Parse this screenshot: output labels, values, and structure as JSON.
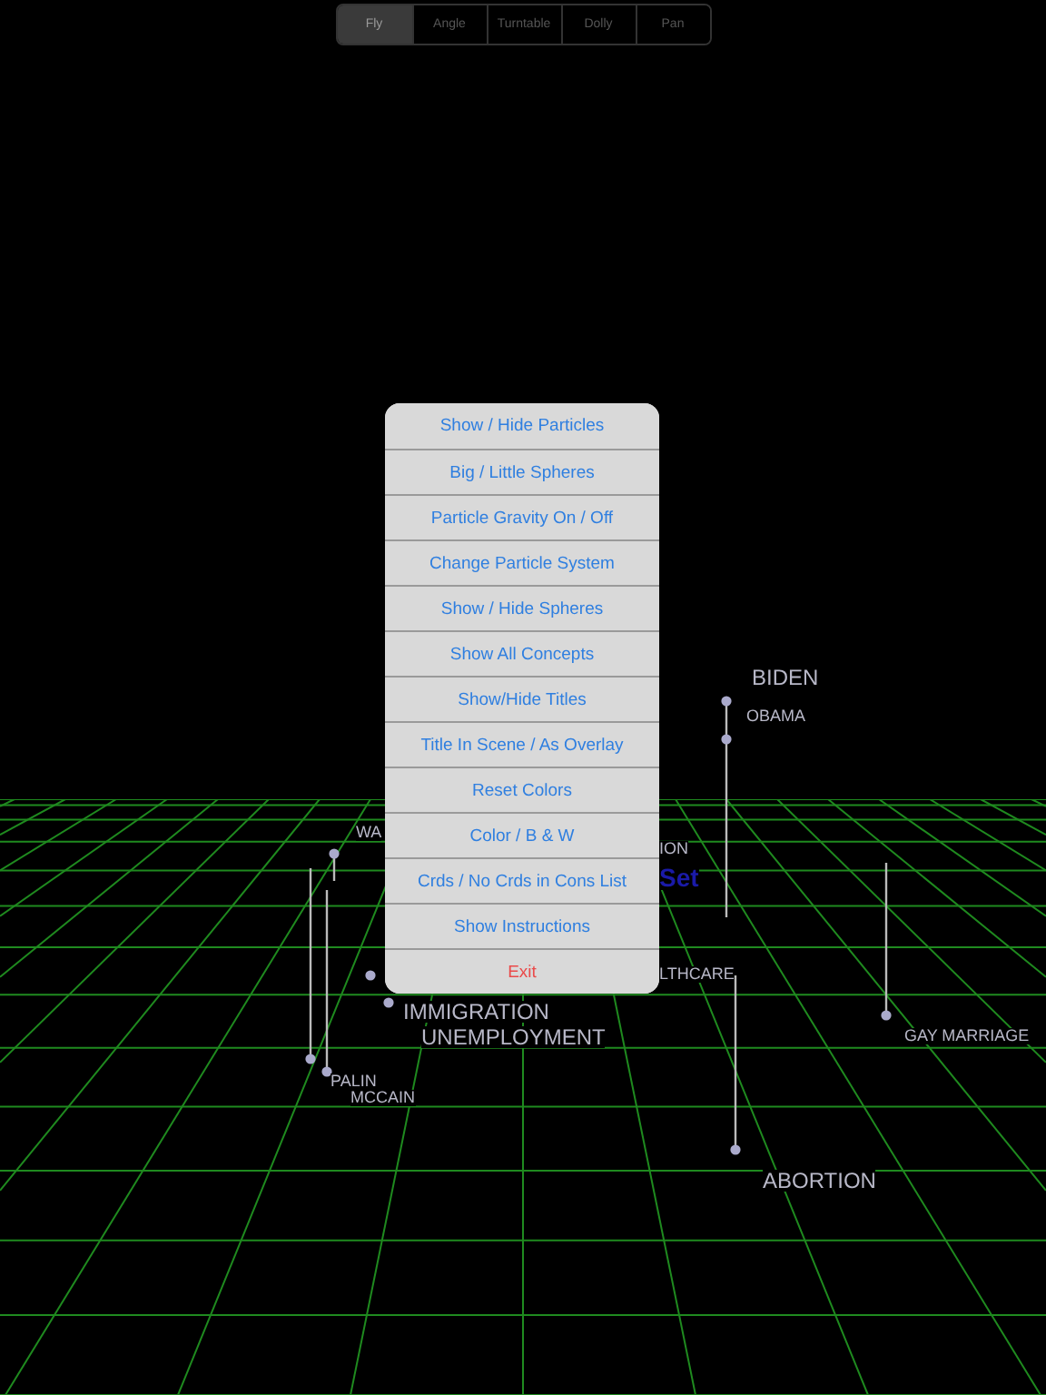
{
  "mode_control": {
    "segments": [
      {
        "label": "Fly",
        "selected": true
      },
      {
        "label": "Angle",
        "selected": false
      },
      {
        "label": "Turntable",
        "selected": false
      },
      {
        "label": "Dolly",
        "selected": false
      },
      {
        "label": "Pan",
        "selected": false
      }
    ]
  },
  "scene": {
    "labels": [
      {
        "text": "BIDEN",
        "kind": "large"
      },
      {
        "text": "OBAMA",
        "kind": "small"
      },
      {
        "text": "WA",
        "kind": "small"
      },
      {
        "text": "ION",
        "kind": "small"
      },
      {
        "text": "Set",
        "kind": "highlight"
      },
      {
        "text": "LTHCARE",
        "kind": "small"
      },
      {
        "text": "IMMIGRATION",
        "kind": "large"
      },
      {
        "text": "UNEMPLOYMENT",
        "kind": "large"
      },
      {
        "text": "PALIN",
        "kind": "small"
      },
      {
        "text": "MCCAIN",
        "kind": "small"
      },
      {
        "text": "GAY MARRIAGE",
        "kind": "small"
      },
      {
        "text": "ABORTION",
        "kind": "large"
      }
    ]
  },
  "menu": {
    "items": [
      {
        "label": "Show / Hide Particles",
        "kind": "action"
      },
      {
        "label": "Big / Little Spheres",
        "kind": "action"
      },
      {
        "label": "Particle Gravity On / Off",
        "kind": "action"
      },
      {
        "label": "Change Particle System",
        "kind": "action"
      },
      {
        "label": "Show / Hide Spheres",
        "kind": "action"
      },
      {
        "label": "Show All Concepts",
        "kind": "action"
      },
      {
        "label": "Show/Hide Titles",
        "kind": "action"
      },
      {
        "label": "Title In Scene / As Overlay",
        "kind": "action"
      },
      {
        "label": "Reset Colors",
        "kind": "action"
      },
      {
        "label": "Color / B & W",
        "kind": "action"
      },
      {
        "label": "Crds / No Crds in Cons List",
        "kind": "action"
      },
      {
        "label": "Show Instructions",
        "kind": "action"
      },
      {
        "label": "Exit",
        "kind": "destructive"
      }
    ]
  }
}
